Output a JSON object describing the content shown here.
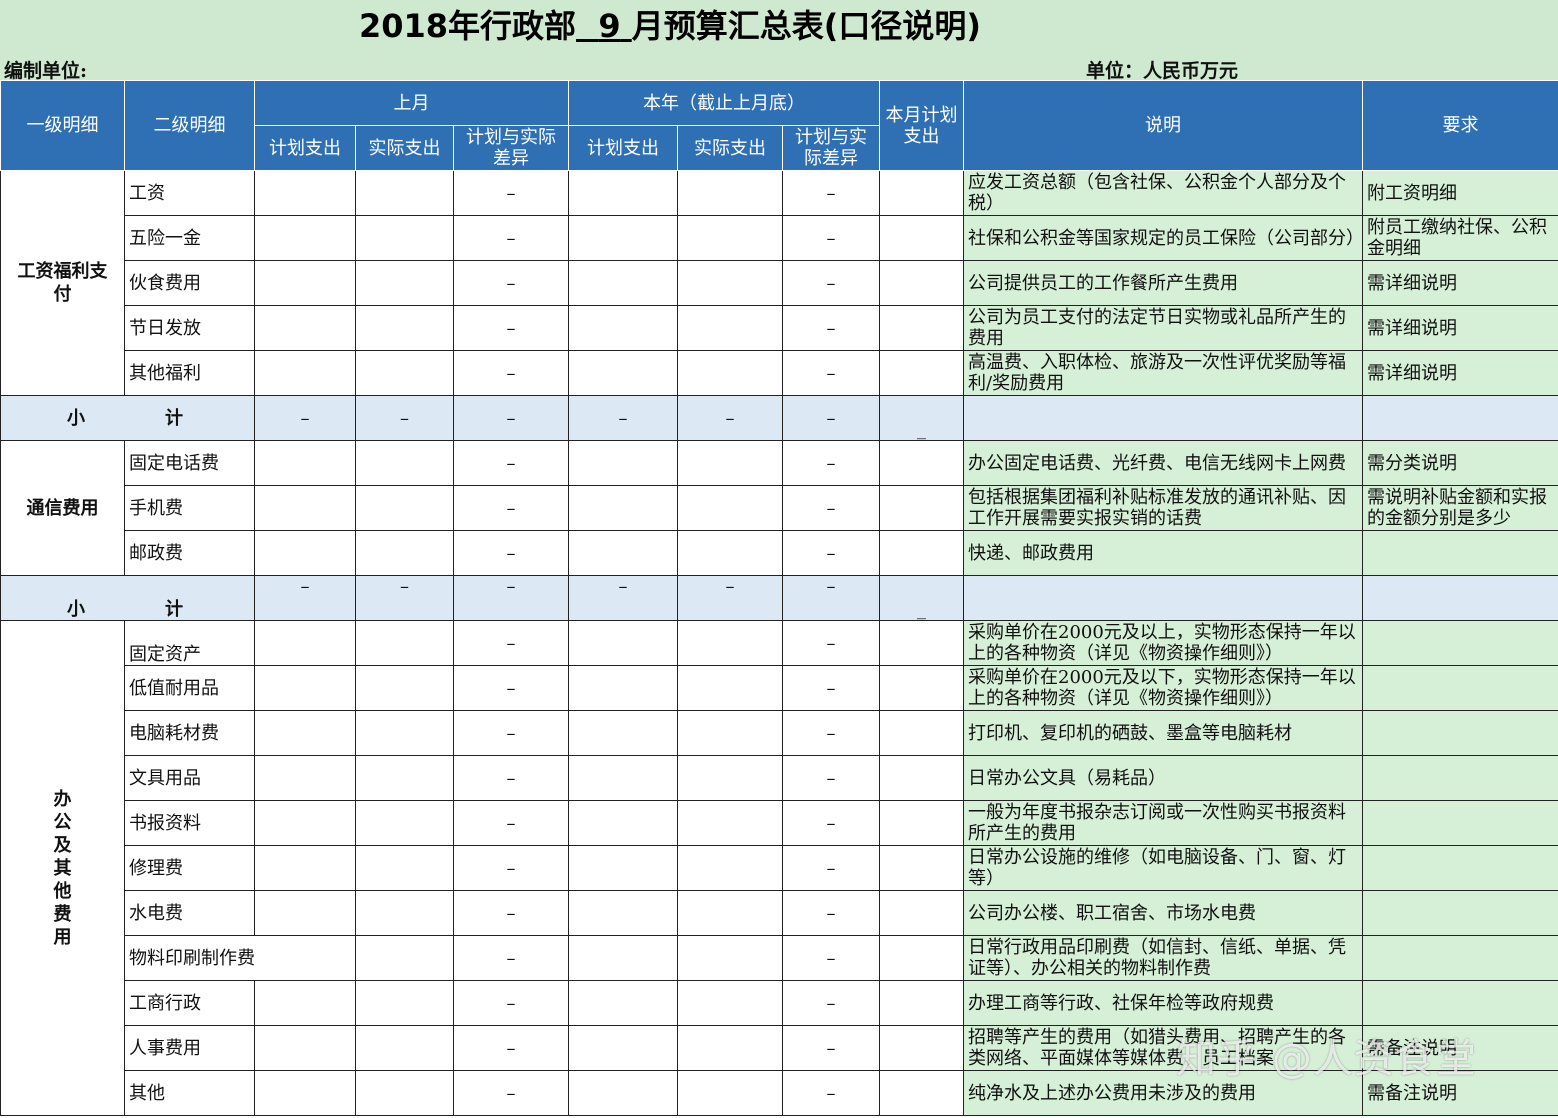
{
  "title_prefix": "2018年行政部",
  "title_month": "9",
  "title_suffix": "月预算汇总表(口径说明)",
  "compile_unit_label": "编制单位:",
  "currency_unit_label": "单位：人民币万元",
  "headers": {
    "level1": "一级明细",
    "level2": "二级明细",
    "last_month": "上月",
    "this_year": "本年（截止上月底）",
    "this_month_plan": "本月计划支出",
    "description": "说明",
    "requirement": "要求",
    "plan_spend": "计划支出",
    "actual_spend": "实际支出",
    "diff": "计划与实际差异"
  },
  "dash": "–",
  "subtotal": {
    "label_a": "小",
    "label_b": "计",
    "dash": "–",
    "underscore": "_"
  },
  "groups": [
    {
      "category": "工资福利支付",
      "rows": [
        {
          "item": "工资",
          "desc": "应发工资总额（包含社保、公积金个人部分及个税）",
          "req": "附工资明细"
        },
        {
          "item": "五险一金",
          "desc": "社保和公积金等国家规定的员工保险（公司部分）",
          "req": "附员工缴纳社保、公积金明细"
        },
        {
          "item": "伙食费用",
          "desc": "公司提供员工的工作餐所产生费用",
          "req": "需详细说明"
        },
        {
          "item": "节日发放",
          "desc": "公司为员工支付的法定节日实物或礼品所产生的费用",
          "req": "需详细说明"
        },
        {
          "item": "其他福利",
          "desc": "高温费、入职体检、旅游及一次性评优奖励等福利/奖励费用",
          "req": "需详细说明"
        }
      ]
    },
    {
      "category": "通信费用",
      "rows": [
        {
          "item": "固定电话费",
          "desc": "办公固定电话费、光纤费、电信无线网卡上网费",
          "req": "需分类说明"
        },
        {
          "item": "手机费",
          "desc": "包括根据集团福利补贴标准发放的通讯补贴、因工作开展需要实报实销的话费",
          "req": "需说明补贴金额和实报的金额分别是多少"
        },
        {
          "item": "邮政费",
          "desc": "快递、邮政费用",
          "req": ""
        }
      ]
    },
    {
      "category": "办公及其他费用",
      "rows": [
        {
          "item": "固定资产",
          "desc": "采购单价在2000元及以上，实物形态保持一年以上的各种物资（详见《物资操作细则》）",
          "req": ""
        },
        {
          "item": "低值耐用品",
          "desc": "采购单价在2000元及以下，实物形态保持一年以上的各种物资（详见《物资操作细则》）",
          "req": ""
        },
        {
          "item": "电脑耗材费",
          "desc": "打印机、复印机的硒鼓、墨盒等电脑耗材",
          "req": ""
        },
        {
          "item": "文具用品",
          "desc": "日常办公文具（易耗品）",
          "req": ""
        },
        {
          "item": "书报资料",
          "desc": "一般为年度书报杂志订阅或一次性购买书报资料所产生的费用",
          "req": ""
        },
        {
          "item": "修理费",
          "desc": "日常办公设施的维修（如电脑设备、门、窗、灯等）",
          "req": ""
        },
        {
          "item": "水电费",
          "desc": "公司办公楼、职工宿舍、市场水电费",
          "req": ""
        },
        {
          "item": "物料印刷制作费",
          "desc": " 日常行政用品印刷费（如信封、信纸、单据、凭证等）、办公相关的物料制作费",
          "req": ""
        },
        {
          "item": "工商行政",
          "desc": "  办理工商等行政、社保年检等政府规费",
          "req": ""
        },
        {
          "item": "人事费用",
          "desc": "招聘等产生的费用（如猎头费用、招聘产生的各类网络、平面媒体等媒体费、员工档案",
          "req": "需备注说明"
        },
        {
          "item": "其他",
          "desc": "纯净水及上述办公费用未涉及的费用",
          "req": "需备注说明"
        }
      ]
    }
  ],
  "watermark": "知乎 @人资食堂"
}
